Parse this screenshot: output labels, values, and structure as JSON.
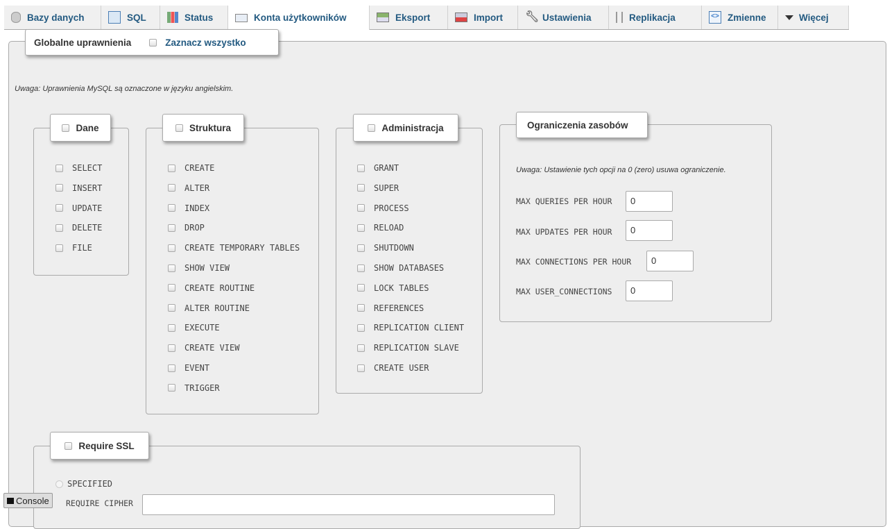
{
  "tabs": [
    {
      "label": "Bazy danych",
      "icon": "database-icon",
      "active": false
    },
    {
      "label": "SQL",
      "icon": "sql-icon",
      "active": false
    },
    {
      "label": "Status",
      "icon": "status-icon",
      "active": false
    },
    {
      "label": "Konta użytkowników",
      "icon": "users-icon",
      "active": true
    },
    {
      "label": "Eksport",
      "icon": "export-icon",
      "active": false
    },
    {
      "label": "Import",
      "icon": "import-icon",
      "active": false
    },
    {
      "label": "Ustawienia",
      "icon": "settings-icon",
      "active": false
    },
    {
      "label": "Replikacja",
      "icon": "replication-icon",
      "active": false
    },
    {
      "label": "Zmienne",
      "icon": "variables-icon",
      "active": false
    },
    {
      "label": "Więcej",
      "icon": "more-caret-icon",
      "active": false
    }
  ],
  "privileges": {
    "legend_title": "Globalne uprawnienia",
    "select_all_label": "Zaznacz wszystko",
    "note": "Uwaga: Uprawnienia MySQL są oznaczone w języku angielskim.",
    "groups": {
      "data": {
        "title": "Dane",
        "items": [
          "SELECT",
          "INSERT",
          "UPDATE",
          "DELETE",
          "FILE"
        ]
      },
      "structure": {
        "title": "Struktura",
        "items": [
          "CREATE",
          "ALTER",
          "INDEX",
          "DROP",
          "CREATE TEMPORARY TABLES",
          "SHOW VIEW",
          "CREATE ROUTINE",
          "ALTER ROUTINE",
          "EXECUTE",
          "CREATE VIEW",
          "EVENT",
          "TRIGGER"
        ]
      },
      "admin": {
        "title": "Administracja",
        "items": [
          "GRANT",
          "SUPER",
          "PROCESS",
          "RELOAD",
          "SHUTDOWN",
          "SHOW DATABASES",
          "LOCK TABLES",
          "REFERENCES",
          "REPLICATION CLIENT",
          "REPLICATION SLAVE",
          "CREATE USER"
        ]
      }
    },
    "limits": {
      "title": "Ograniczenia zasobów",
      "note": "Uwaga: Ustawienie tych opcji na 0 (zero) usuwa ograniczenie.",
      "rows": [
        {
          "label": "MAX QUERIES PER HOUR",
          "value": "0"
        },
        {
          "label": "MAX UPDATES PER HOUR",
          "value": "0"
        },
        {
          "label": "MAX CONNECTIONS PER HOUR",
          "value": "0"
        },
        {
          "label": "MAX USER_CONNECTIONS",
          "value": "0"
        }
      ]
    },
    "ssl": {
      "title": "Require SSL",
      "specified_label": "SPECIFIED",
      "require_cipher_label": "REQUIRE CIPHER"
    }
  },
  "console": {
    "label": "Console"
  }
}
